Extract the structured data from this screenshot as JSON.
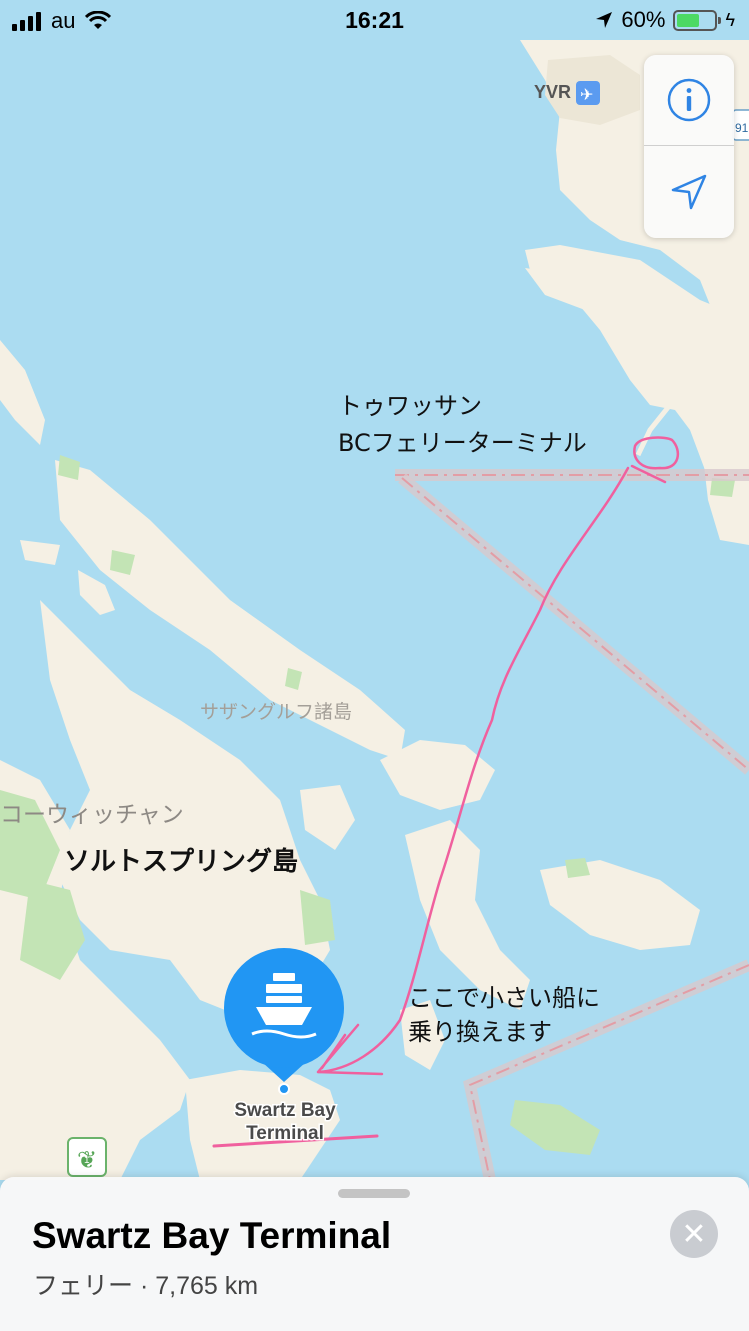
{
  "status_bar": {
    "carrier": "au",
    "time": "16:21",
    "battery_percent": "60%",
    "battery_level": 0.6,
    "icons": [
      "signal-bars-icon",
      "wifi-icon",
      "location-arrow-icon",
      "battery-icon",
      "charging-bolt-icon"
    ]
  },
  "map": {
    "labels": {
      "airport": "YVR",
      "highway_badge_right": "91",
      "highway_badge_left": "1",
      "gulf_islands": "サザングルフ諸島",
      "cowichan": "コーウィッチャン",
      "terminal_line1": "Swartz Bay",
      "terminal_line2": "Terminal"
    },
    "handwriting": {
      "tsawwassen_line1": "トゥワッサン",
      "tsawwassen_line2": "BCフェリーターミナル",
      "saltspring": "ソルトスプリング島",
      "transfer_line1": "ここで小さい船に",
      "transfer_line2": "乗り換えます"
    },
    "colors": {
      "water": "#abdcf1",
      "land": "#f5f0e4",
      "park": "#c3e4b5",
      "accent": "#2196f3",
      "annotation": "#f0609e"
    }
  },
  "map_controls": {
    "info_icon": "info-icon",
    "location_icon": "location-arrow-icon"
  },
  "place_card": {
    "title": "Swartz Bay Terminal",
    "subtitle": "フェリー · 7,765 km",
    "pin_icon": "ferry-icon",
    "close_icon": "close-icon"
  }
}
